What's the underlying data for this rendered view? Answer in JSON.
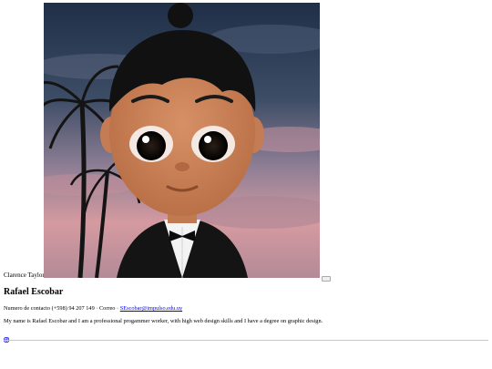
{
  "profile": {
    "photo_caption": "Clarence Taylor",
    "photo_icon": "avatar-illustration",
    "name": "Rafael Escobar",
    "contact_prefix": "Numero de contacto (+598) 94 207 149 · Correo · ",
    "email": "SEscobar@impulso.edu.uy",
    "bio": "My name is Rafael Escobar and I am a professional progammer worker, with high web design skills and I have a degree on graphic design.",
    "social_icon": "instagram-icon"
  },
  "colors": {
    "link": "#0000ee",
    "sky_top": "#2c3f5a",
    "sky_bottom": "#d59aa0"
  }
}
